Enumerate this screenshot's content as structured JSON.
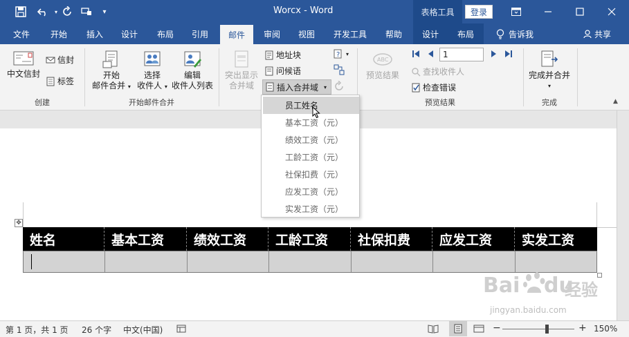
{
  "app": {
    "doc_title": "Worcx - Word",
    "context_tools_label": "表格工具",
    "login_label": "登录"
  },
  "tabs": [
    {
      "label": "文件"
    },
    {
      "label": "开始"
    },
    {
      "label": "插入"
    },
    {
      "label": "设计"
    },
    {
      "label": "布局"
    },
    {
      "label": "引用"
    },
    {
      "label": "邮件"
    },
    {
      "label": "审阅"
    },
    {
      "label": "视图"
    },
    {
      "label": "开发工具"
    },
    {
      "label": "帮助"
    },
    {
      "label": "设计"
    },
    {
      "label": "布局"
    },
    {
      "label": "告诉我"
    },
    {
      "label": "共享"
    }
  ],
  "ribbon": {
    "create": {
      "label": "创建",
      "chinese_envelope": "中文信封",
      "envelope": "信封",
      "labels": "标签"
    },
    "start_merge": {
      "label": "开始邮件合并",
      "start_line1": "开始",
      "start_line2": "邮件合并",
      "select_line1": "选择",
      "select_line2": "收件人",
      "edit_line1": "编辑",
      "edit_line2": "收件人列表"
    },
    "write_insert": {
      "highlight_line1": "突出显示",
      "highlight_line2": "合并域",
      "address_block": "地址块",
      "greeting_line": "问候语",
      "insert_merge_field": "插入合并域"
    },
    "preview": {
      "label": "预览结果",
      "preview_results": "预览结果",
      "page_value": "1",
      "find_recipient": "查找收件人",
      "check_errors": "检查错误"
    },
    "finish": {
      "label": "完成",
      "finish_merge": "完成并合并"
    }
  },
  "dropdown": {
    "items": [
      "员工姓名",
      "基本工资（元）",
      "绩效工资（元）",
      "工龄工资（元）",
      "社保扣费（元）",
      "应发工资（元）",
      "实发工资（元）"
    ]
  },
  "table": {
    "headers": [
      "姓名",
      "基本工资",
      "绩效工资",
      "工龄工资",
      "社保扣费",
      "应发工资",
      "实发工资"
    ]
  },
  "status": {
    "page": "第 1 页，共 1 页",
    "words": "26 个字",
    "language": "中文(中国)",
    "zoom": "150%"
  },
  "watermark": {
    "brand": "Bai",
    "brand_du": "du",
    "experience": "经验",
    "url": "jingyan.baidu.com"
  },
  "colors": {
    "word_blue": "#2b579a",
    "context_blue": "#1e4a8a",
    "header_black": "#000000",
    "row_gray": "#d3d3d3"
  }
}
